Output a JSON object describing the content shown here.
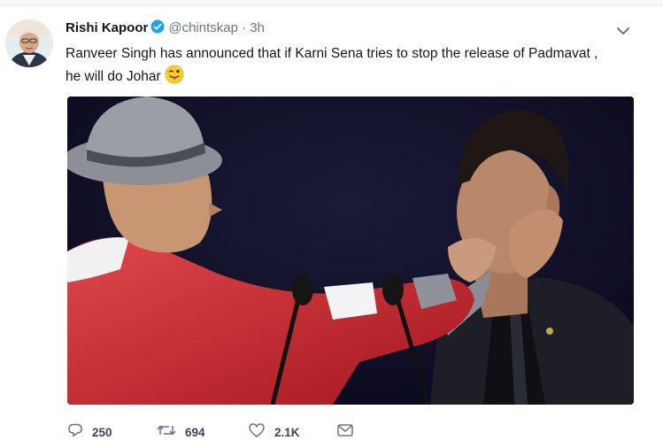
{
  "tweet": {
    "author_name": "Rishi Kapoor",
    "handle": "@chintskap",
    "separator": "·",
    "time": "3h",
    "verified_icon": "verified-badge-icon",
    "text": "Ranveer Singh has announced that if Karni Sena tries to stop the release of Padmavat , he will do Johar",
    "emoji": "winking-face-with-tongue",
    "media": "photo"
  },
  "actions": {
    "reply_count": "250",
    "retweet_count": "694",
    "like_count": "2.1K",
    "reply_icon": "reply-icon",
    "retweet_icon": "retweet-icon",
    "like_icon": "heart-icon",
    "dm_icon": "envelope-icon"
  },
  "colors": {
    "verified": "#1da1f2",
    "text": "#14171a",
    "secondary": "#657786",
    "icon": "#657786"
  }
}
